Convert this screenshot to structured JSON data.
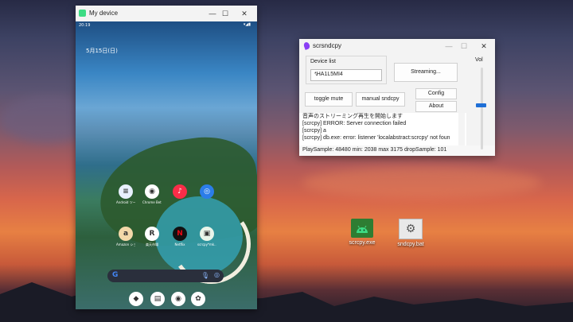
{
  "phone_window": {
    "title": "My device",
    "min_glyph": "—",
    "max_glyph": "☐",
    "close_glyph": "✕",
    "status_time": "20:19",
    "status_right": "▾◢▮",
    "date": "5月15日(日)",
    "apps_row1": [
      {
        "icon": "tool-icon",
        "label": "Android ツールボックス",
        "color": "#e8f0fe",
        "glyph": "≡"
      },
      {
        "icon": "chrome-icon",
        "label": "Chrome Beta",
        "color": "#ffffff",
        "glyph": "◉"
      },
      {
        "icon": "music-icon",
        "label": "",
        "color": "#fa2d48",
        "glyph": "♪"
      },
      {
        "icon": "cast-icon",
        "label": "",
        "color": "#2b7de9",
        "glyph": "◎"
      }
    ],
    "apps_row2": [
      {
        "icon": "amazon-icon",
        "label": "Amazon ショ...",
        "color": "#f3d8a9",
        "glyph": "a"
      },
      {
        "icon": "rakuten-icon",
        "label": "楽天市場",
        "color": "#ffffff",
        "glyph": "R"
      },
      {
        "icon": "netflix-icon",
        "label": "Netflix",
        "color": "#111111",
        "glyph": "N"
      },
      {
        "icon": "scrcpy-icon",
        "label": "scrcpy*mk...",
        "color": "#e9f5ea",
        "glyph": "▣"
      }
    ],
    "dock": [
      {
        "icon": "maps-icon",
        "color": "#ffffff",
        "glyph": "◆"
      },
      {
        "icon": "calendar-icon",
        "color": "#ffffff",
        "glyph": "▤"
      },
      {
        "icon": "chrome-icon",
        "color": "#ffffff",
        "glyph": "◉"
      },
      {
        "icon": "photos-icon",
        "color": "#ffffff",
        "glyph": "✿"
      }
    ],
    "search": {
      "g": "G",
      "mic": "🎙",
      "lens": "◎"
    }
  },
  "scrsndcpy": {
    "title": "scrsndcpy",
    "device_list_label": "Device list",
    "device_selected": "*HA1L5MI4",
    "streaming_button": "Streaming...",
    "config_button": "Config",
    "about_button": "About",
    "toggle_mute_button": "toggle mute",
    "manual_button": "manual sndcpy",
    "vol_label": "Vol",
    "volume_level": 0.56,
    "log": [
      "音声のストリーミング再生を開始します",
      "[scrcpy] ERROR: Server connection failed",
      "[scrcpy] a",
      "[scrcpy] db.exe: error: listener 'localabstract:scrcpy' not foun"
    ],
    "status": "PlaySample: 48480 min: 2038 max 3175 dropSample: 101"
  },
  "desktop_icons": [
    {
      "icon": "android-icon",
      "label": "scrcpy.exe"
    },
    {
      "icon": "gear-file-icon",
      "label": "sndcpy.bat"
    }
  ]
}
